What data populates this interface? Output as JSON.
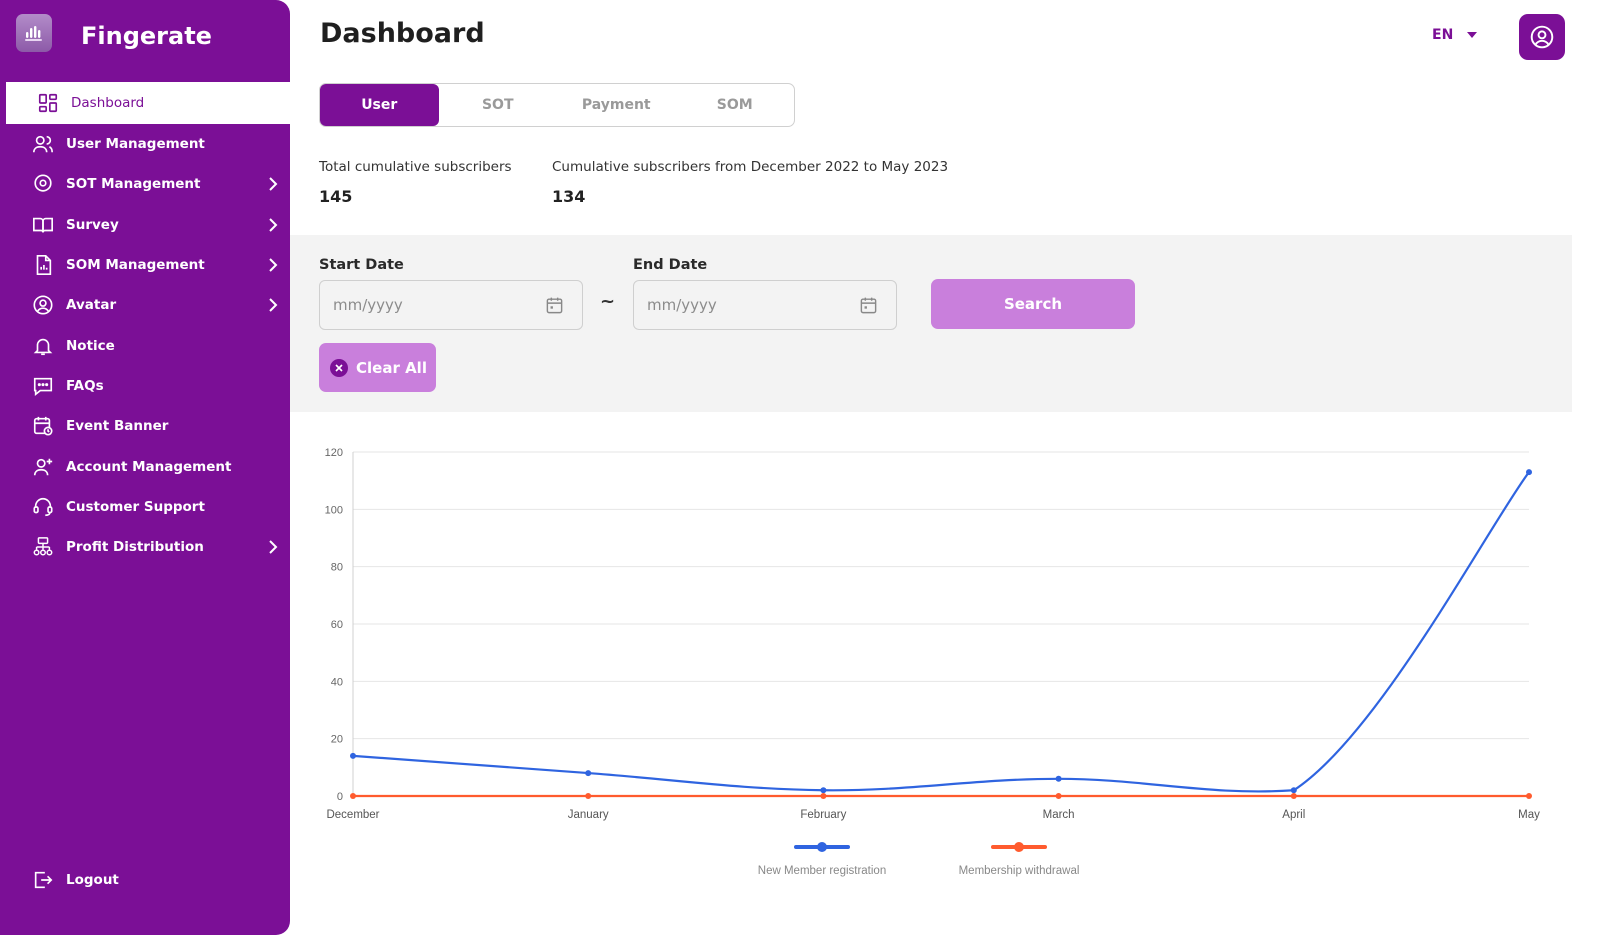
{
  "brand": {
    "name": "Fingerate"
  },
  "sidebar": {
    "items": [
      {
        "label": "Dashboard",
        "icon": "dashboard-grid-icon",
        "active": true,
        "has_submenu": false
      },
      {
        "label": "User Management",
        "icon": "users-icon",
        "active": false,
        "has_submenu": false
      },
      {
        "label": "SOT Management",
        "icon": "location-pin-icon",
        "active": false,
        "has_submenu": true
      },
      {
        "label": "Survey",
        "icon": "book-open-icon",
        "active": false,
        "has_submenu": true
      },
      {
        "label": "SOM Management",
        "icon": "document-chart-icon",
        "active": false,
        "has_submenu": true
      },
      {
        "label": "Avatar",
        "icon": "user-circle-icon",
        "active": false,
        "has_submenu": true
      },
      {
        "label": "Notice",
        "icon": "bell-icon",
        "active": false,
        "has_submenu": false
      },
      {
        "label": "FAQs",
        "icon": "chat-bubble-icon",
        "active": false,
        "has_submenu": false
      },
      {
        "label": "Event Banner",
        "icon": "calendar-clock-icon",
        "active": false,
        "has_submenu": false
      },
      {
        "label": "Account Management",
        "icon": "user-plus-icon",
        "active": false,
        "has_submenu": false
      },
      {
        "label": "Customer Support",
        "icon": "headset-icon",
        "active": false,
        "has_submenu": false
      },
      {
        "label": "Profit Distribution",
        "icon": "org-chart-icon",
        "active": false,
        "has_submenu": true
      }
    ],
    "logout_label": "Logout"
  },
  "header": {
    "title": "Dashboard",
    "language": "EN"
  },
  "tabs": [
    {
      "label": "User",
      "active": true
    },
    {
      "label": "SOT",
      "active": false
    },
    {
      "label": "Payment",
      "active": false
    },
    {
      "label": "SOM",
      "active": false
    }
  ],
  "stats": {
    "total_label": "Total cumulative subscribers",
    "total_value": "145",
    "range_label": "Cumulative subscribers from December 2022 to May 2023",
    "range_value": "134"
  },
  "filter": {
    "start_label": "Start Date",
    "start_placeholder": "mm/yyyy",
    "end_label": "End Date",
    "end_placeholder": "mm/yyyy",
    "separator": "~",
    "search_label": "Search",
    "clear_label": "Clear All"
  },
  "colors": {
    "primary": "#7b0f96",
    "button_light": "#c97fdc",
    "series_registration": "#2f64e0",
    "series_withdrawal": "#ff5b2e"
  },
  "chart_data": {
    "type": "line",
    "categories": [
      "December",
      "January",
      "February",
      "March",
      "April",
      "May"
    ],
    "ylim": [
      0,
      120
    ],
    "yticks": [
      0,
      20,
      40,
      60,
      80,
      100,
      120
    ],
    "grid": true,
    "legend_position": "bottom",
    "series": [
      {
        "name": "New Member registration",
        "color": "#2f64e0",
        "values": [
          14,
          8,
          2,
          6,
          2,
          113
        ]
      },
      {
        "name": "Membership withdrawal",
        "color": "#ff5b2e",
        "values": [
          0,
          0,
          0,
          0,
          0,
          0
        ]
      }
    ]
  }
}
